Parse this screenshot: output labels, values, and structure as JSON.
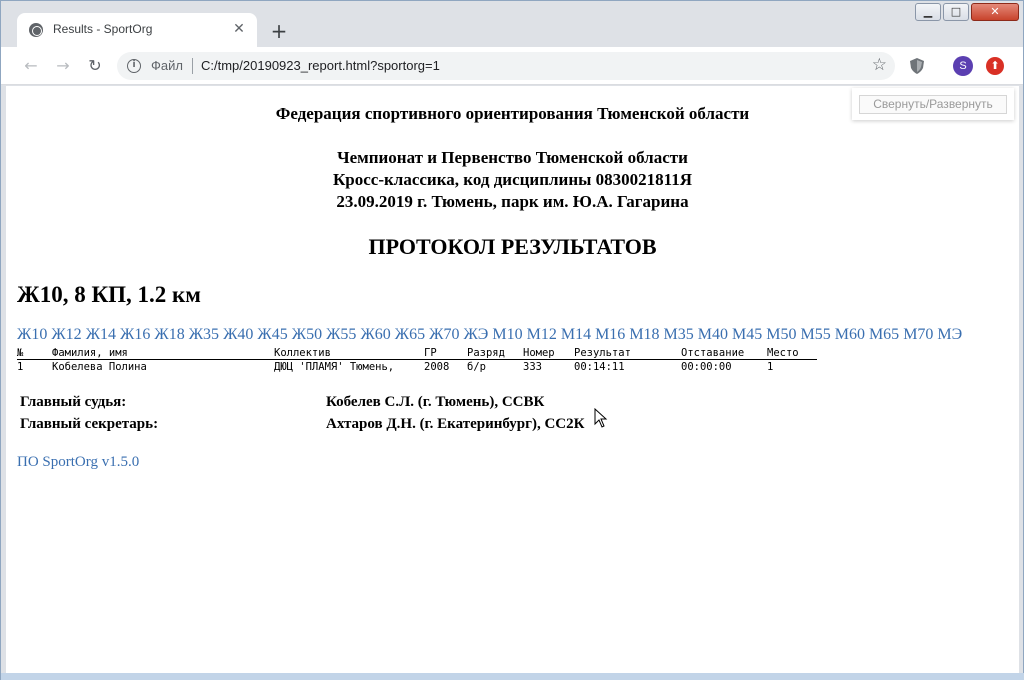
{
  "browser": {
    "tab_title": "Results - SportOrg",
    "tab_close": "✕",
    "new_tab": "+",
    "address_scheme": "Файл",
    "address_url": "C:/tmp/20190923_report.html?sportorg=1",
    "profile_initial": "S",
    "icons": [
      "globe-icon",
      "back-arrow-icon",
      "forward-arrow-icon",
      "reload-icon",
      "info-icon",
      "star-icon",
      "shield-extension-icon",
      "update-icon"
    ],
    "window_controls": {
      "minimize": "▁",
      "maximize": "□",
      "close": "✕"
    }
  },
  "page": {
    "collapse_button": "Свернуть/Развернуть",
    "federation": "Федерация спортивного ориентирования Тюменской области",
    "event_lines": [
      "Чемпионат и Первенство Тюменской области",
      "Кросс-классика, код дисциплины 0830021811Я",
      "23.09.2019 г. Тюмень, парк им. Ю.А. Гагарина"
    ],
    "protocol_title": "ПРОТОКОЛ РЕЗУЛЬТАТОВ",
    "group_title": "Ж10, 8 КП, 1.2 км",
    "group_links": [
      "Ж10",
      "Ж12",
      "Ж14",
      "Ж16",
      "Ж18",
      "Ж35",
      "Ж40",
      "Ж45",
      "Ж50",
      "Ж55",
      "Ж60",
      "Ж65",
      "Ж70",
      "ЖЭ",
      "М10",
      "М12",
      "М14",
      "М16",
      "М18",
      "М35",
      "М40",
      "М45",
      "М50",
      "М55",
      "М60",
      "М65",
      "М70",
      "МЭ"
    ],
    "table": {
      "headers": [
        "№",
        "Фамилия, имя",
        "Коллектив",
        "ГР",
        "Разряд",
        "Номер",
        "Результат",
        "Отставание",
        "Место"
      ],
      "rows": [
        [
          "1",
          "Кобелева Полина",
          "ДЮЦ 'ПЛАМЯ' Тюмень,",
          "2008",
          "б/р",
          "333",
          "00:14:11",
          "00:00:00",
          "1"
        ]
      ]
    },
    "officials": [
      {
        "role": "Главный судья:",
        "name": "Кобелев С.Л. (г. Тюмень), ССВК"
      },
      {
        "role": "Главный секретарь:",
        "name": "Ахтаров Д.Н. (г. Екатеринбург), СС2К"
      }
    ],
    "software": "ПО SportOrg v1.5.0"
  },
  "colors": {
    "link": "#3a6fb0",
    "avatar": "#5b3fb1",
    "update": "#d93025"
  }
}
